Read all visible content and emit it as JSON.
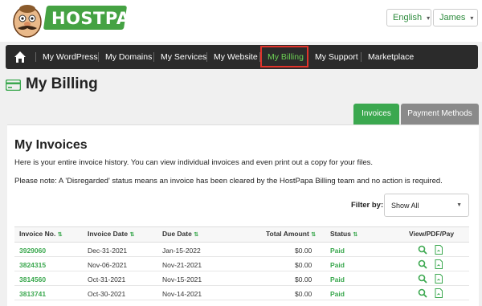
{
  "brand": {
    "logo_text": "HOSTPAPA"
  },
  "header": {
    "language": "English",
    "user": "James"
  },
  "nav": {
    "items": [
      {
        "label": "My WordPress"
      },
      {
        "label": "My Domains"
      },
      {
        "label": "My Services"
      },
      {
        "label": "My Website"
      },
      {
        "label": "My Billing"
      },
      {
        "label": "My Support"
      },
      {
        "label": "Marketplace"
      }
    ],
    "active": "My Billing"
  },
  "page": {
    "title": "My Billing"
  },
  "tabs": [
    {
      "label": "Invoices"
    },
    {
      "label": "Payment Methods"
    }
  ],
  "invoices": {
    "title": "My Invoices",
    "intro": "Here is your entire invoice history. You can view individual invoices and even print out a copy for your files.",
    "note": "Please note: A 'Disregarded' status means an invoice has been cleared by the HostPapa Billing team and no action is required.",
    "filter_label": "Filter by:",
    "filter_value": "Show All",
    "columns": [
      "Invoice No.",
      "Invoice Date",
      "Due Date",
      "Total Amount",
      "Status",
      "View/PDF/Pay"
    ],
    "rows": [
      {
        "number": "3929060",
        "invoice_date": "Dec-31-2021",
        "due_date": "Jan-15-2022",
        "amount": "$0.00",
        "status": "Paid"
      },
      {
        "number": "3824315",
        "invoice_date": "Nov-06-2021",
        "due_date": "Nov-21-2021",
        "amount": "$0.00",
        "status": "Paid"
      },
      {
        "number": "3814560",
        "invoice_date": "Oct-31-2021",
        "due_date": "Nov-15-2021",
        "amount": "$0.00",
        "status": "Paid"
      },
      {
        "number": "3813741",
        "invoice_date": "Oct-30-2021",
        "due_date": "Nov-14-2021",
        "amount": "$0.00",
        "status": "Paid"
      }
    ]
  },
  "colors": {
    "brand_green": "#3ba84f",
    "nav_bg": "#2b2b2b",
    "highlight": "#e0332b"
  }
}
